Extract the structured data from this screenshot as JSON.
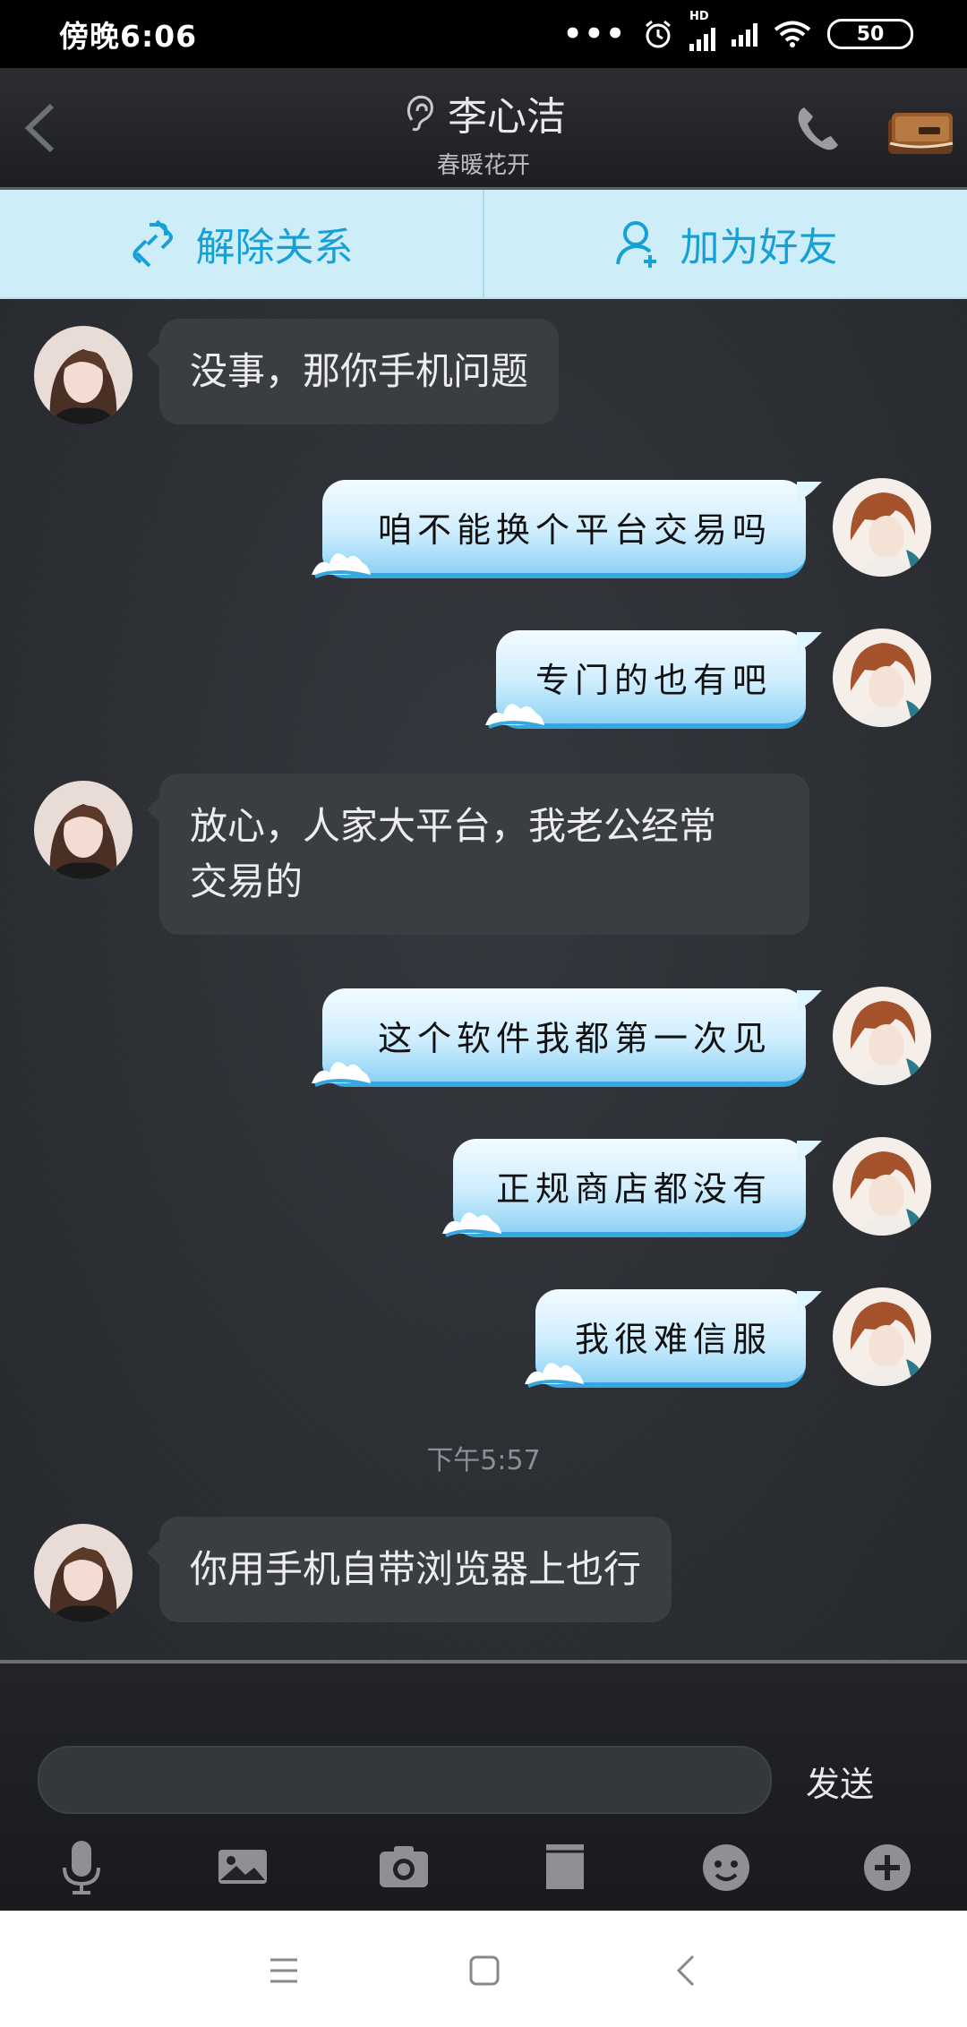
{
  "status_bar": {
    "time": "傍晚6:06",
    "signal_label": "HD",
    "battery": "50"
  },
  "header": {
    "title": "李心洁",
    "subtitle": "春暖花开"
  },
  "actions": {
    "unlink_label": "解除关系",
    "add_friend_label": "加为好友"
  },
  "messages": [
    {
      "side": "left",
      "text": "没事，那你手机问题"
    },
    {
      "side": "right",
      "text": "咱不能换个平台交易吗"
    },
    {
      "side": "right",
      "text": "专门的也有吧"
    },
    {
      "side": "left",
      "text_line1": "放心，人家大平台，我老公经常",
      "text_line2": "交易的"
    },
    {
      "side": "right",
      "text": "这个软件我都第一次见"
    },
    {
      "side": "right",
      "text": "正规商店都没有"
    },
    {
      "side": "right",
      "text": "我很难信服"
    },
    {
      "side": "left",
      "text": "你用手机自带浏览器上也行"
    }
  ],
  "timestamp": "下午5:57",
  "input": {
    "value": "",
    "send_label": "发送"
  },
  "toolbar_icons": [
    "microphone-icon",
    "image-icon",
    "camera-icon",
    "folder-icon",
    "emoji-icon",
    "plus-icon"
  ],
  "colors": {
    "accent": "#17a0d6",
    "action_bar_bg": "#cdeef8",
    "bubble_left": "#3a3d42",
    "bubble_right_edge": "#39a6e0"
  }
}
